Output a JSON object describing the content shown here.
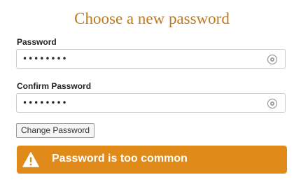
{
  "page": {
    "title": "Choose a new password"
  },
  "form": {
    "password": {
      "label": "Password",
      "value": "mypasswd"
    },
    "confirm_password": {
      "label": "Confirm Password",
      "value": "mypasswd"
    },
    "submit_label": "Change Password"
  },
  "alert": {
    "icon": "warning-icon",
    "message": "Password is too common"
  },
  "colors": {
    "title": "#c07a1d",
    "alert_background": "#e08a1a"
  }
}
